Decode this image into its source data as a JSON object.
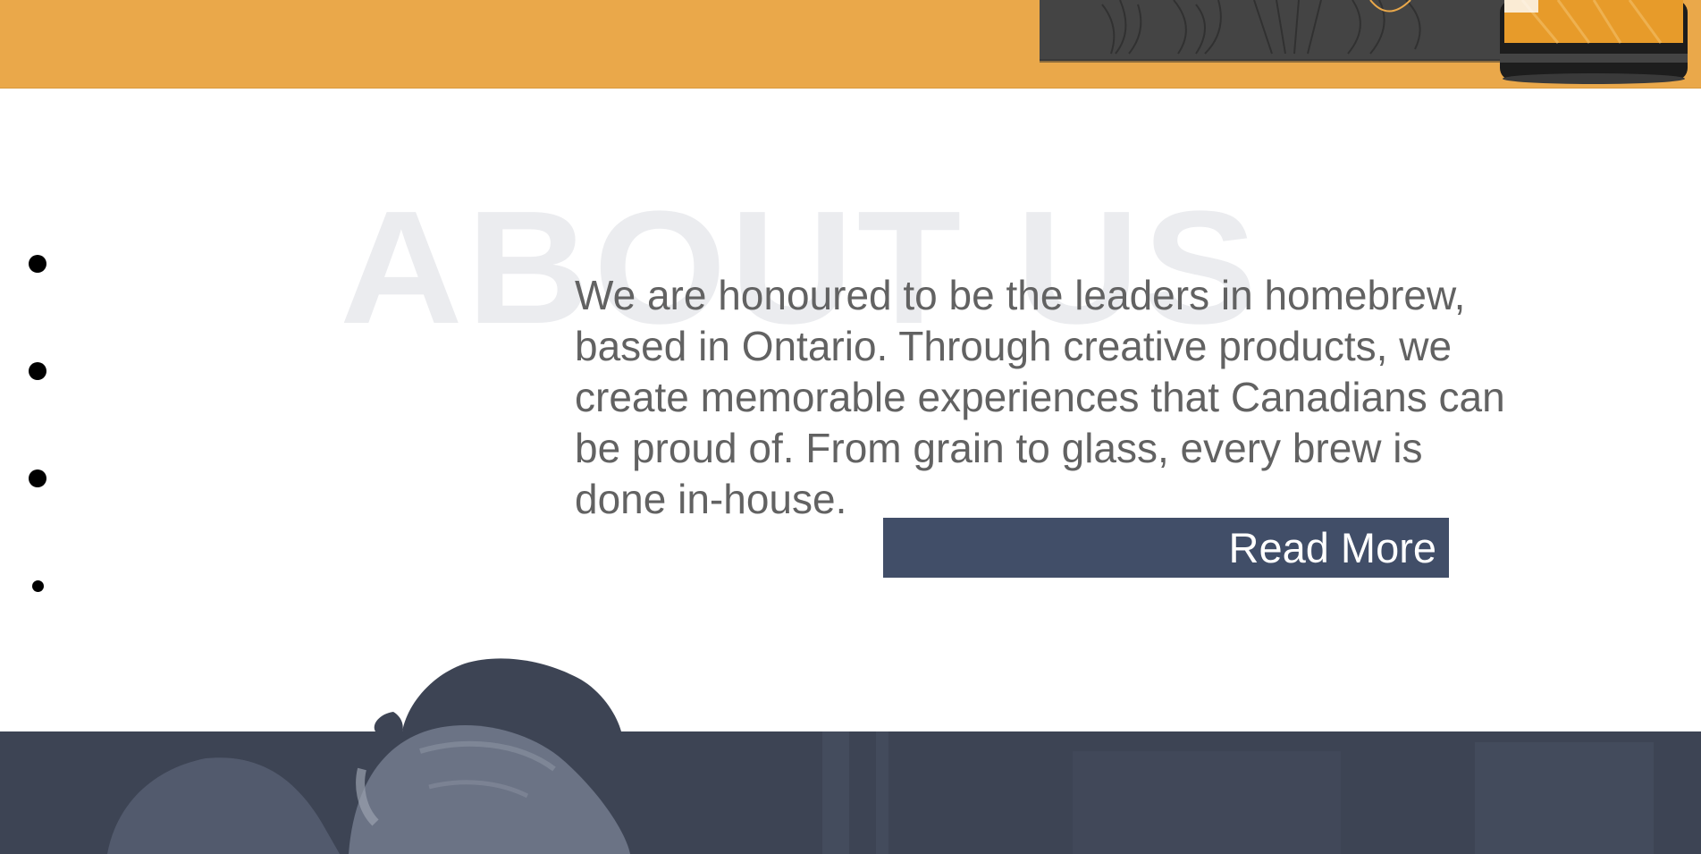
{
  "about": {
    "watermark": "ABOUT US",
    "body": "We are honoured to be the leaders in homebrew, based in Ontario. Through creative products, we create memorable experiences that Canadians can be proud of. From grain to glass, every brew is done in-house.",
    "read_more_label": "Read More"
  },
  "colors": {
    "accent_orange": "#eaa84a",
    "button_navy": "#414e68",
    "footer_slate": "#3d4454",
    "watermark_gray": "#ebecef",
    "body_text": "#626262"
  },
  "icons": [
    "bullet-dot-icon"
  ]
}
